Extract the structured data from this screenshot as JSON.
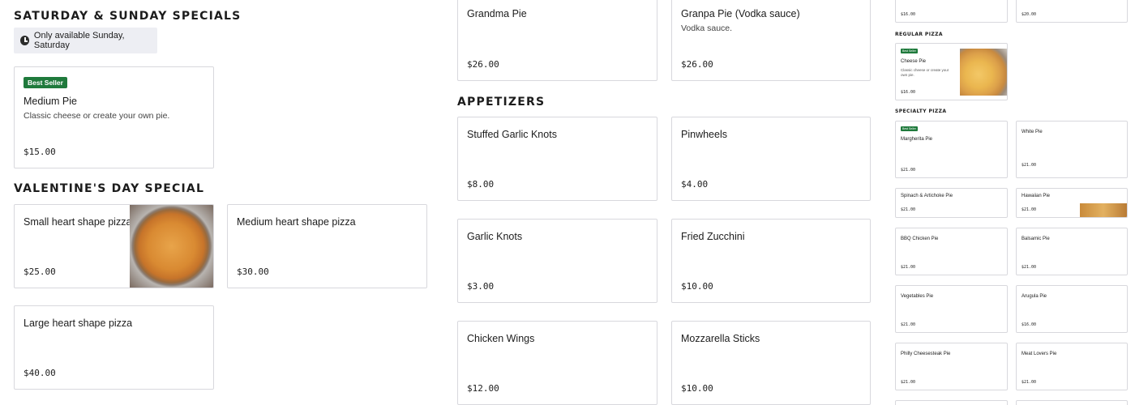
{
  "left": {
    "weekend_heading": "SATURDAY & SUNDAY SPECIALS",
    "notice": "Only available Sunday, Saturday",
    "medium_pie": {
      "badge": "Best Seller",
      "name": "Medium Pie",
      "desc": "Classic cheese or create your own pie.",
      "price": "$15.00"
    },
    "valentines_heading": "VALENTINE'S DAY SPECIAL",
    "valentines_items": [
      {
        "name": "Small heart shape pizza",
        "price": "$25.00"
      },
      {
        "name": "Medium heart shape pizza",
        "price": "$30.00"
      },
      {
        "name": "Large heart shape pizza",
        "price": "$40.00"
      }
    ]
  },
  "middle": {
    "top_items": [
      {
        "name": "Grandma Pie",
        "desc": "",
        "price": "$26.00"
      },
      {
        "name": "Granpa Pie (Vodka sauce)",
        "desc": "Vodka sauce.",
        "price": "$26.00"
      }
    ],
    "appetizers_heading": "APPETIZERS",
    "appetizers": [
      {
        "name": "Stuffed Garlic Knots",
        "price": "$8.00"
      },
      {
        "name": "Pinwheels",
        "price": "$4.00"
      },
      {
        "name": "Garlic Knots",
        "price": "$3.00"
      },
      {
        "name": "Fried Zucchini",
        "price": "$10.00"
      },
      {
        "name": "Chicken Wings",
        "price": "$12.00"
      },
      {
        "name": "Mozzarella Sticks",
        "price": "$10.00"
      }
    ]
  },
  "right": {
    "top_prices": [
      "$16.00",
      "$20.00"
    ],
    "regular_heading": "REGULAR PIZZA",
    "cheese_pie": {
      "badge": "Best Seller",
      "name": "Cheese Pie",
      "desc": "Classic cheese or create your own pie.",
      "price": "$16.00"
    },
    "specialty_heading": "SPECIALTY PIZZA",
    "specialty": [
      {
        "name": "Margherita Pie",
        "price": "$21.00",
        "badge": "Best Seller"
      },
      {
        "name": "White Pie",
        "price": "$21.00"
      },
      {
        "name": "Spinach & Artichoke Pie",
        "price": "$21.00"
      },
      {
        "name": "Hawaiian Pie",
        "price": "$21.00"
      },
      {
        "name": "BBQ Chicken Pie",
        "price": "$21.00"
      },
      {
        "name": "Balsamic Pie",
        "price": "$21.00"
      },
      {
        "name": "Vegetables Pie",
        "price": "$21.00"
      },
      {
        "name": "Arugula Pie",
        "price": "$16.00"
      },
      {
        "name": "Philly Cheesesteak Pie",
        "price": "$21.00"
      },
      {
        "name": "Meat Lovers Pie",
        "price": "$21.00"
      }
    ]
  },
  "colors": {
    "badge_green": "#1f7a3c",
    "border": "#d8d8dd",
    "notice_bg": "#edeef3"
  }
}
